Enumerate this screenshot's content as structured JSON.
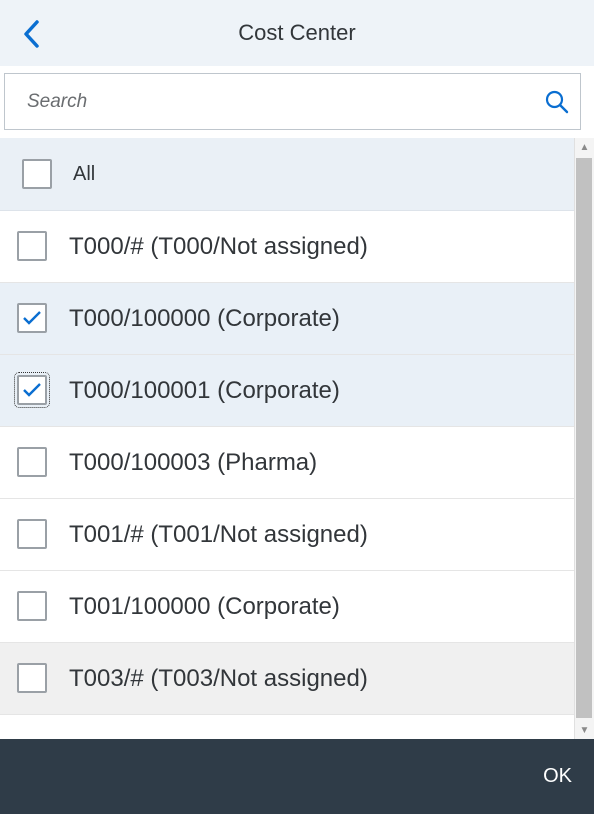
{
  "header": {
    "title": "Cost Center",
    "back_icon": "chevron-left-icon"
  },
  "search": {
    "placeholder": "Search",
    "value": "",
    "icon": "search-icon"
  },
  "select_all": {
    "label": "All",
    "checked": false
  },
  "items": [
    {
      "label": "T000/# (T000/Not assigned)",
      "checked": false
    },
    {
      "label": "T000/100000 (Corporate)",
      "checked": true
    },
    {
      "label": "T000/100001 (Corporate)",
      "checked": true
    },
    {
      "label": "T000/100003 (Pharma)",
      "checked": false
    },
    {
      "label": "T001/# (T001/Not assigned)",
      "checked": false
    },
    {
      "label": "T001/100000 (Corporate)",
      "checked": false
    },
    {
      "label": "T003/# (T003/Not assigned)",
      "checked": false
    }
  ],
  "footer": {
    "ok_label": "OK"
  },
  "colors": {
    "header_bg": "#eef3f8",
    "accent": "#0a6ed1",
    "selected_row": "#e9f0f7",
    "footer_bg": "#2f3c48"
  }
}
